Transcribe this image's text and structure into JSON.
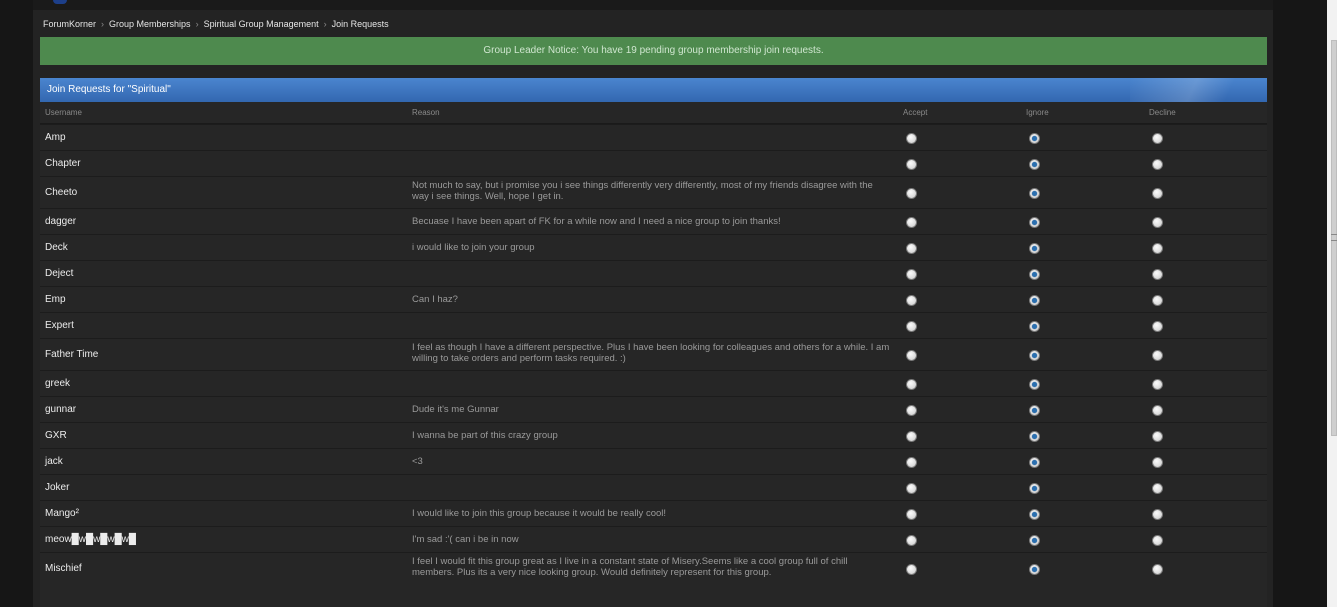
{
  "breadcrumb": [
    "ForumKorner",
    "Group Memberships",
    "Spiritual Group Management",
    "Join Requests"
  ],
  "notice": "Group Leader Notice: You have 19 pending group membership join requests.",
  "panel_title": "Join Requests for \"Spiritual\"",
  "columns": {
    "username": "Username",
    "reason": "Reason",
    "accept": "Accept",
    "ignore": "Ignore",
    "decline": "Decline"
  },
  "requests": [
    {
      "user": "Amp",
      "reason": "",
      "choice": "ignore"
    },
    {
      "user": "Chapter",
      "reason": "",
      "choice": "ignore"
    },
    {
      "user": "Cheeto",
      "reason": "Not much to say, but i promise you i see things differently very differently, most of my friends disagree with the way i see things. Well, hope I get in.",
      "choice": "ignore"
    },
    {
      "user": "dagger",
      "reason": "Becuase I have been apart of FK for a while now and I need a nice group to join thanks!",
      "choice": "ignore"
    },
    {
      "user": "Deck",
      "reason": "i would like to join your group",
      "choice": "ignore"
    },
    {
      "user": "Deject",
      "reason": "",
      "choice": "ignore"
    },
    {
      "user": "Emp",
      "reason": "Can I haz?",
      "choice": "ignore"
    },
    {
      "user": "Expert",
      "reason": "",
      "choice": "ignore"
    },
    {
      "user": "Father Time",
      "reason": "I feel as though I have a different perspective. Plus I have been looking for colleagues and others for a while. I am willing to take orders and perform tasks required. :)",
      "choice": "ignore"
    },
    {
      "user": "greek",
      "reason": "",
      "choice": "ignore"
    },
    {
      "user": "gunnar",
      "reason": "Dude it's me Gunnar",
      "choice": "ignore"
    },
    {
      "user": "GXR",
      "reason": "I wanna be part of this crazy group",
      "choice": "ignore"
    },
    {
      "user": "jack",
      "reason": "<3",
      "choice": "ignore"
    },
    {
      "user": "Joker",
      "reason": "",
      "choice": "ignore"
    },
    {
      "user": "Mango²",
      "reason": "I would like to join this group because it would be really cool!",
      "choice": "ignore"
    },
    {
      "user": "meow█w█w█w█w█",
      "reason": "I'm sad :'( can i be in now",
      "choice": "ignore"
    },
    {
      "user": "Mischief",
      "reason": "I feel I would fit this group great as I live in a constant state of Misery.Seems like a cool group full of chill members. Plus its a very nice looking group. Would definitely represent for this group.",
      "choice": "ignore"
    }
  ]
}
